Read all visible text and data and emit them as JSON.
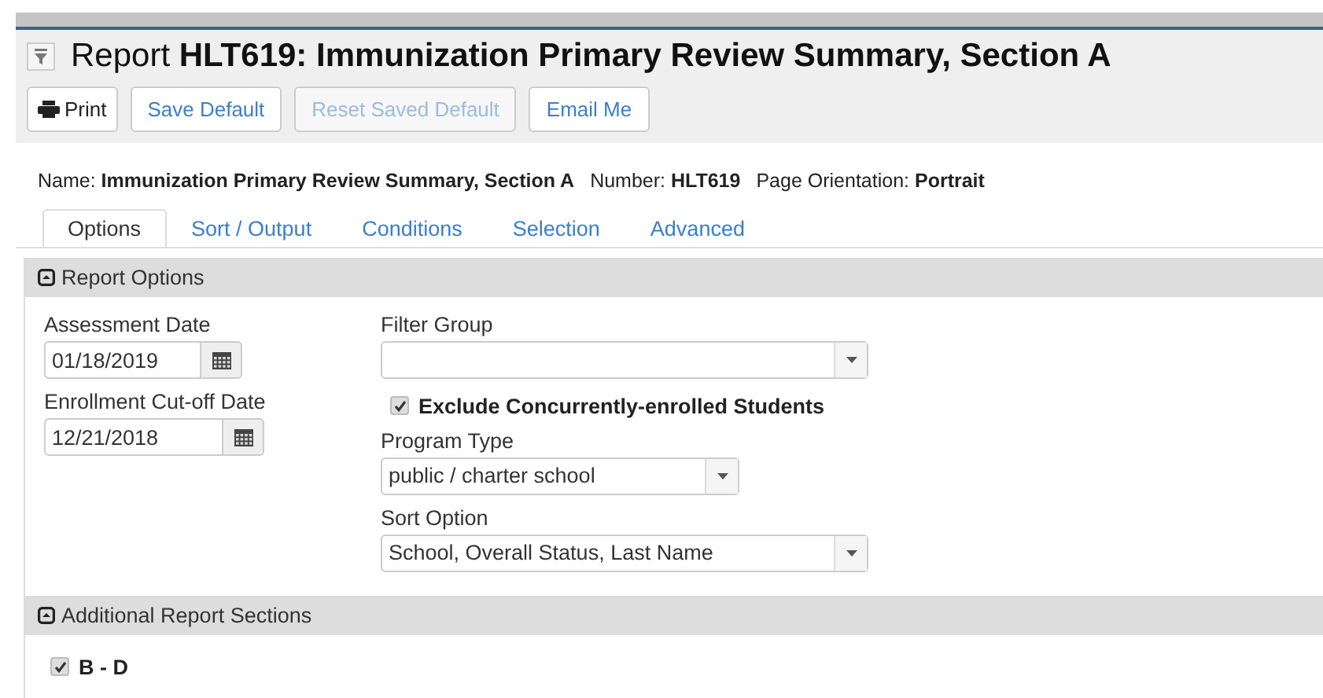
{
  "header": {
    "title": "Report **HLT619: Immunization Primary Review Summary, Section A**"
  },
  "buttons": [
    {
      "label": "Print",
      "kind": "print",
      "disabled": false
    },
    {
      "label": "Save Default",
      "kind": "plain",
      "disabled": false
    },
    {
      "label": "Reset Saved Default",
      "kind": "plain",
      "disabled": true
    },
    {
      "label": "Email Me",
      "kind": "plain",
      "disabled": false
    }
  ],
  "info": [
    "Name: **Immunization Primary Review Summary, Section A**",
    "Number: **HLT619**",
    "Page Orientation: **Portrait**"
  ],
  "tabs": [
    {
      "label": "Options",
      "selected": true
    },
    {
      "label": "Sort / Output",
      "selected": false
    },
    {
      "label": "Conditions",
      "selected": false
    },
    {
      "label": "Selection",
      "selected": false
    },
    {
      "label": "Advanced",
      "selected": false
    }
  ],
  "report_options": {
    "title": "Report Options",
    "left": [
      {
        "label": "Assessment Date",
        "value": "01/18/2019"
      },
      {
        "label": "Enrollment Cut-off Date",
        "value": "12/21/2018"
      }
    ],
    "right": [
      {
        "kind": "select",
        "label": "Filter Group",
        "wide": true
      },
      {
        "kind": "checkbox",
        "label": "Exclude Concurrently-enrolled Students",
        "checked": true
      },
      {
        "kind": "select",
        "label": "Program Type",
        "value": "public / charter school",
        "wide": false
      },
      {
        "kind": "select",
        "label": "Sort Option",
        "value": "School, Overall Status, Last Name",
        "wide": true
      }
    ]
  },
  "additional_sections": {
    "title": "Additional Report Sections",
    "items": [
      {
        "label": "B - D",
        "checked": true
      }
    ]
  }
}
